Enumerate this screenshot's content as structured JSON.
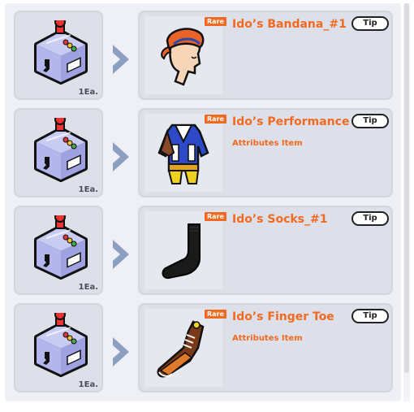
{
  "rewards": [
    {
      "quantity": "1Ea.",
      "badge": "Rare",
      "name": "Ido’s Bandana_#1",
      "subtitle": "",
      "tip_label": "Tip",
      "item_icon": "bandana-icon"
    },
    {
      "quantity": "1Ea.",
      "badge": "Rare",
      "name": "Ido’s Performance",
      "subtitle": "Attributes Item",
      "tip_label": "Tip",
      "item_icon": "performance-outfit-icon"
    },
    {
      "quantity": "1Ea.",
      "badge": "Rare",
      "name": "Ido’s Socks_#1",
      "subtitle": "",
      "tip_label": "Tip",
      "item_icon": "sock-icon"
    },
    {
      "quantity": "1Ea.",
      "badge": "Rare",
      "name": "Ido’s Finger Toe",
      "subtitle": "Attributes Item",
      "tip_label": "Tip",
      "item_icon": "sneaker-icon"
    }
  ],
  "colors": {
    "accent": "#f26a21",
    "card_bg": "#dde0e9",
    "panel_bg": "#eef0f5",
    "arrow": "#8c9ec2"
  }
}
